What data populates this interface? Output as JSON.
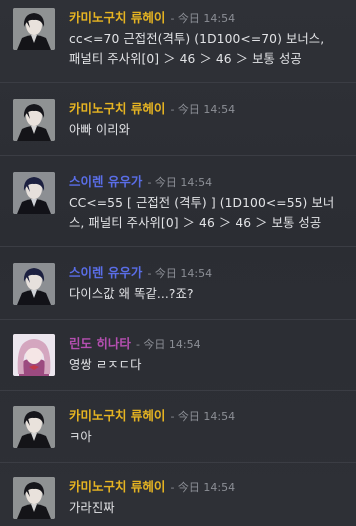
{
  "colors": {
    "author_ryuhei": "#e6b422",
    "author_yuuga": "#5a6ee8",
    "author_hinata": "#b44fb0",
    "text": "#e2e3e6",
    "timestamp": "#8c8f96"
  },
  "messages": [
    {
      "author": "카미노구치 류헤이",
      "timestamp": "- 今日 14:54",
      "lines": [
        "cc<=70 근접전(격투) (1D100<=70) 보너스,",
        "패널티 주사위[0] ＞ 46 ＞ 46 ＞ 보통 성공"
      ]
    },
    {
      "author": "카미노구치 류헤이",
      "timestamp": "- 今日 14:54",
      "lines": [
        "아빠 이리와"
      ]
    },
    {
      "author": "스이렌 유우가",
      "timestamp": "- 今日 14:54",
      "lines": [
        "CC<=55  [ 근접전 (격투) ] (1D100<=55) 보너",
        "스, 패널티 주사위[0] ＞ 46 ＞ 46 ＞ 보통 성공"
      ]
    },
    {
      "author": "스이렌 유우가",
      "timestamp": "- 今日 14:54",
      "lines": [
        "다이스값 왜 똑같...?죠?"
      ]
    },
    {
      "author": "린도 히나타",
      "timestamp": "- 今日 14:54",
      "lines": [
        "영쌍 ㄹㅈㄷ다"
      ]
    },
    {
      "author": "카미노구치 류헤이",
      "timestamp": "- 今日 14:54",
      "lines": [
        "ㅋ아"
      ]
    },
    {
      "author": "카미노구치 류헤이",
      "timestamp": "- 今日 14:54",
      "lines": [
        "가라진짜"
      ]
    }
  ]
}
